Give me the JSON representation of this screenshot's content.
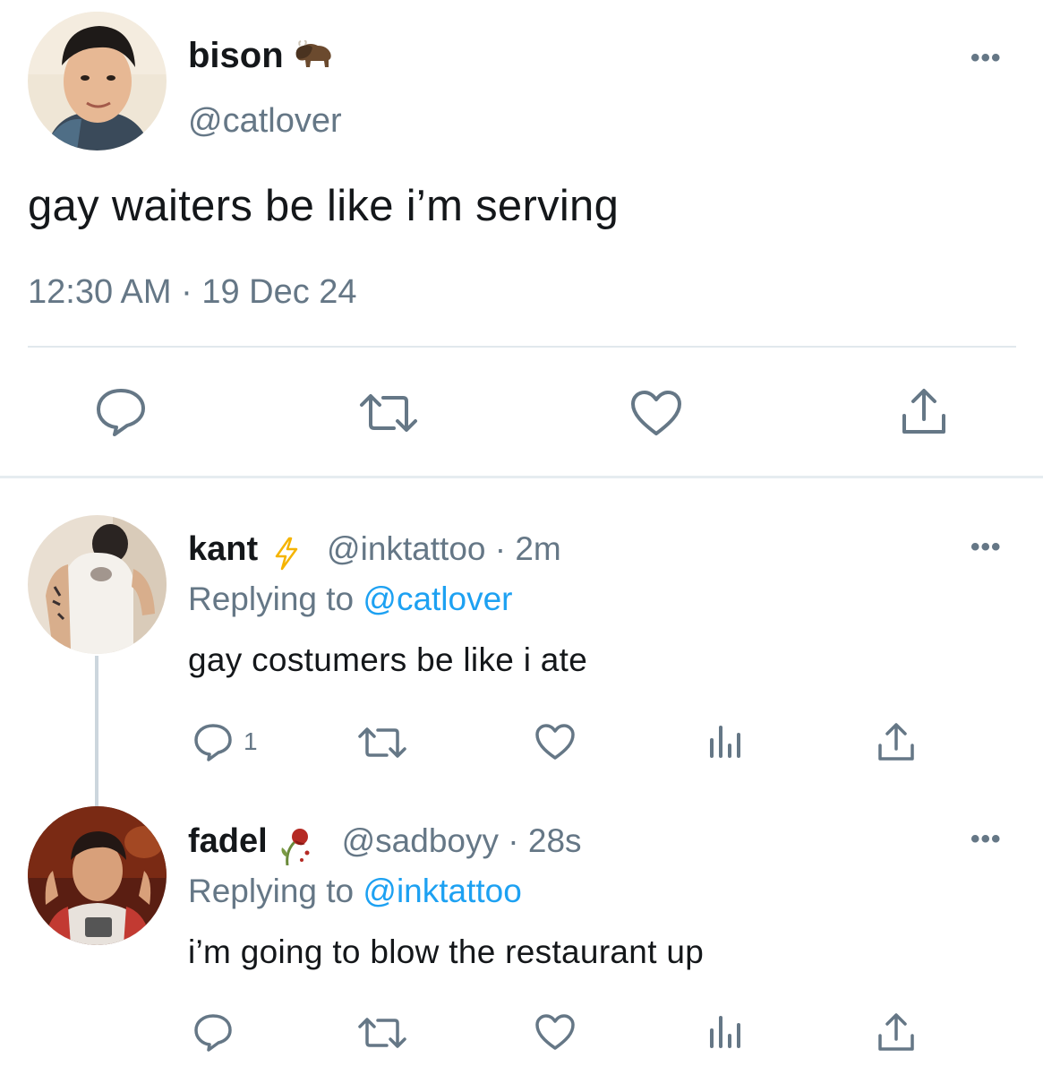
{
  "main_tweet": {
    "name": "bison",
    "name_emoji": "bison-emoji",
    "handle": "@catlover",
    "text": "gay waiters be like i’m serving",
    "timestamp": "12:30 AM · 19 Dec 24",
    "more": "•••"
  },
  "replies": [
    {
      "name": "kant",
      "name_emoji": "lightning-emoji",
      "meta": "@inktattoo · 2m",
      "replying_prefix": "Replying to ",
      "replying_mention": "@catlover",
      "text": "gay costumers be like i ate",
      "reply_count": "1",
      "more": "•••"
    },
    {
      "name": "fadel",
      "name_emoji": "wilted-flower-emoji",
      "meta": "@sadboyy · 28s",
      "replying_prefix": "Replying to ",
      "replying_mention": "@inktattoo",
      "text": "i’m going to blow the restaurant up",
      "reply_count": "",
      "more": "•••"
    }
  ],
  "colors": {
    "text": "#14171a",
    "secondary": "#657786",
    "mention": "#1da1f2",
    "divider": "#e1e8ed"
  }
}
